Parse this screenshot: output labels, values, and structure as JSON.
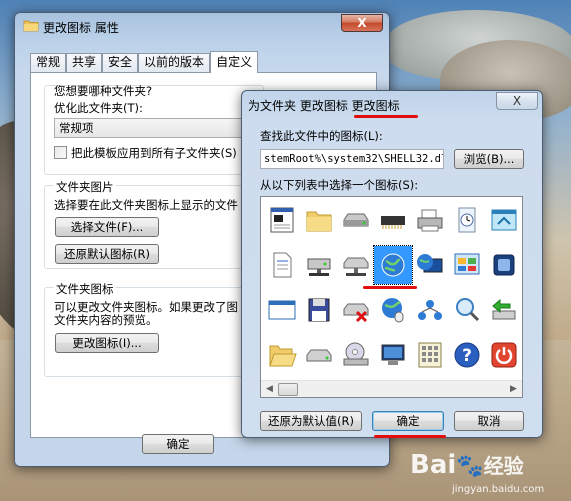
{
  "window_properties": {
    "title": "更改图标 属性",
    "close_label": "X",
    "tabs": [
      {
        "label": "常规"
      },
      {
        "label": "共享"
      },
      {
        "label": "安全"
      },
      {
        "label": "以前的版本"
      },
      {
        "label": "自定义",
        "active": true
      }
    ],
    "folder_type_heading": "您想要哪种文件夹?",
    "optimize_label": "优化此文件夹(T):",
    "optimize_value": "常规项",
    "apply_template_label": "把此模板应用到所有子文件夹(S)",
    "folder_picture_heading": "文件夹图片",
    "folder_picture_desc": "选择要在此文件夹图标上显示的文件",
    "choose_file_button": "选择文件(F)...",
    "restore_default_button": "还原默认图标(R)",
    "folder_icon_heading": "文件夹图标",
    "folder_icon_desc_line1": "可以更改文件夹图标。如果更改了图",
    "folder_icon_desc_line2": "文件夹内容的预览。",
    "change_icon_button": "更改图标(I)...",
    "ok_button": "确定"
  },
  "dialog_change_icon": {
    "title": "为文件夹 更改图标 更改图标",
    "close_label": "X",
    "find_label": "查找此文件中的图标(L):",
    "path_value": "stemRoot%\\system32\\SHELL32.dll",
    "browse_button": "浏览(B)...",
    "list_label": "从以下列表中选择一个图标(S):",
    "restore_defaults_button": "还原为默认值(R)",
    "ok_button": "确定",
    "cancel_button": "取消",
    "icons": [
      "window-text-icon",
      "folder-icon",
      "drive-icon",
      "memory-chip-icon",
      "printer-icon",
      "clock-icon",
      "window-arrow-icon",
      "document-icon",
      "network-drive-icon",
      "network-drive-2-icon",
      "globe-icon",
      "globe-monitor-icon",
      "control-panel-icon",
      "cube-icon",
      "window-blank-icon",
      "floppy-icon",
      "drive-x-icon",
      "globe-mouse-icon",
      "network-users-icon",
      "magnifier-icon",
      "green-arrow-drive-icon",
      "folder-open-icon",
      "drive-flat-icon",
      "cd-drive-icon",
      "monitor-icon",
      "keypad-icon",
      "help-icon",
      "power-icon"
    ],
    "selected_index": 10
  },
  "watermark": {
    "brand": "Bai",
    "brand2": "经验",
    "url": "jingyan.baidu.com"
  }
}
